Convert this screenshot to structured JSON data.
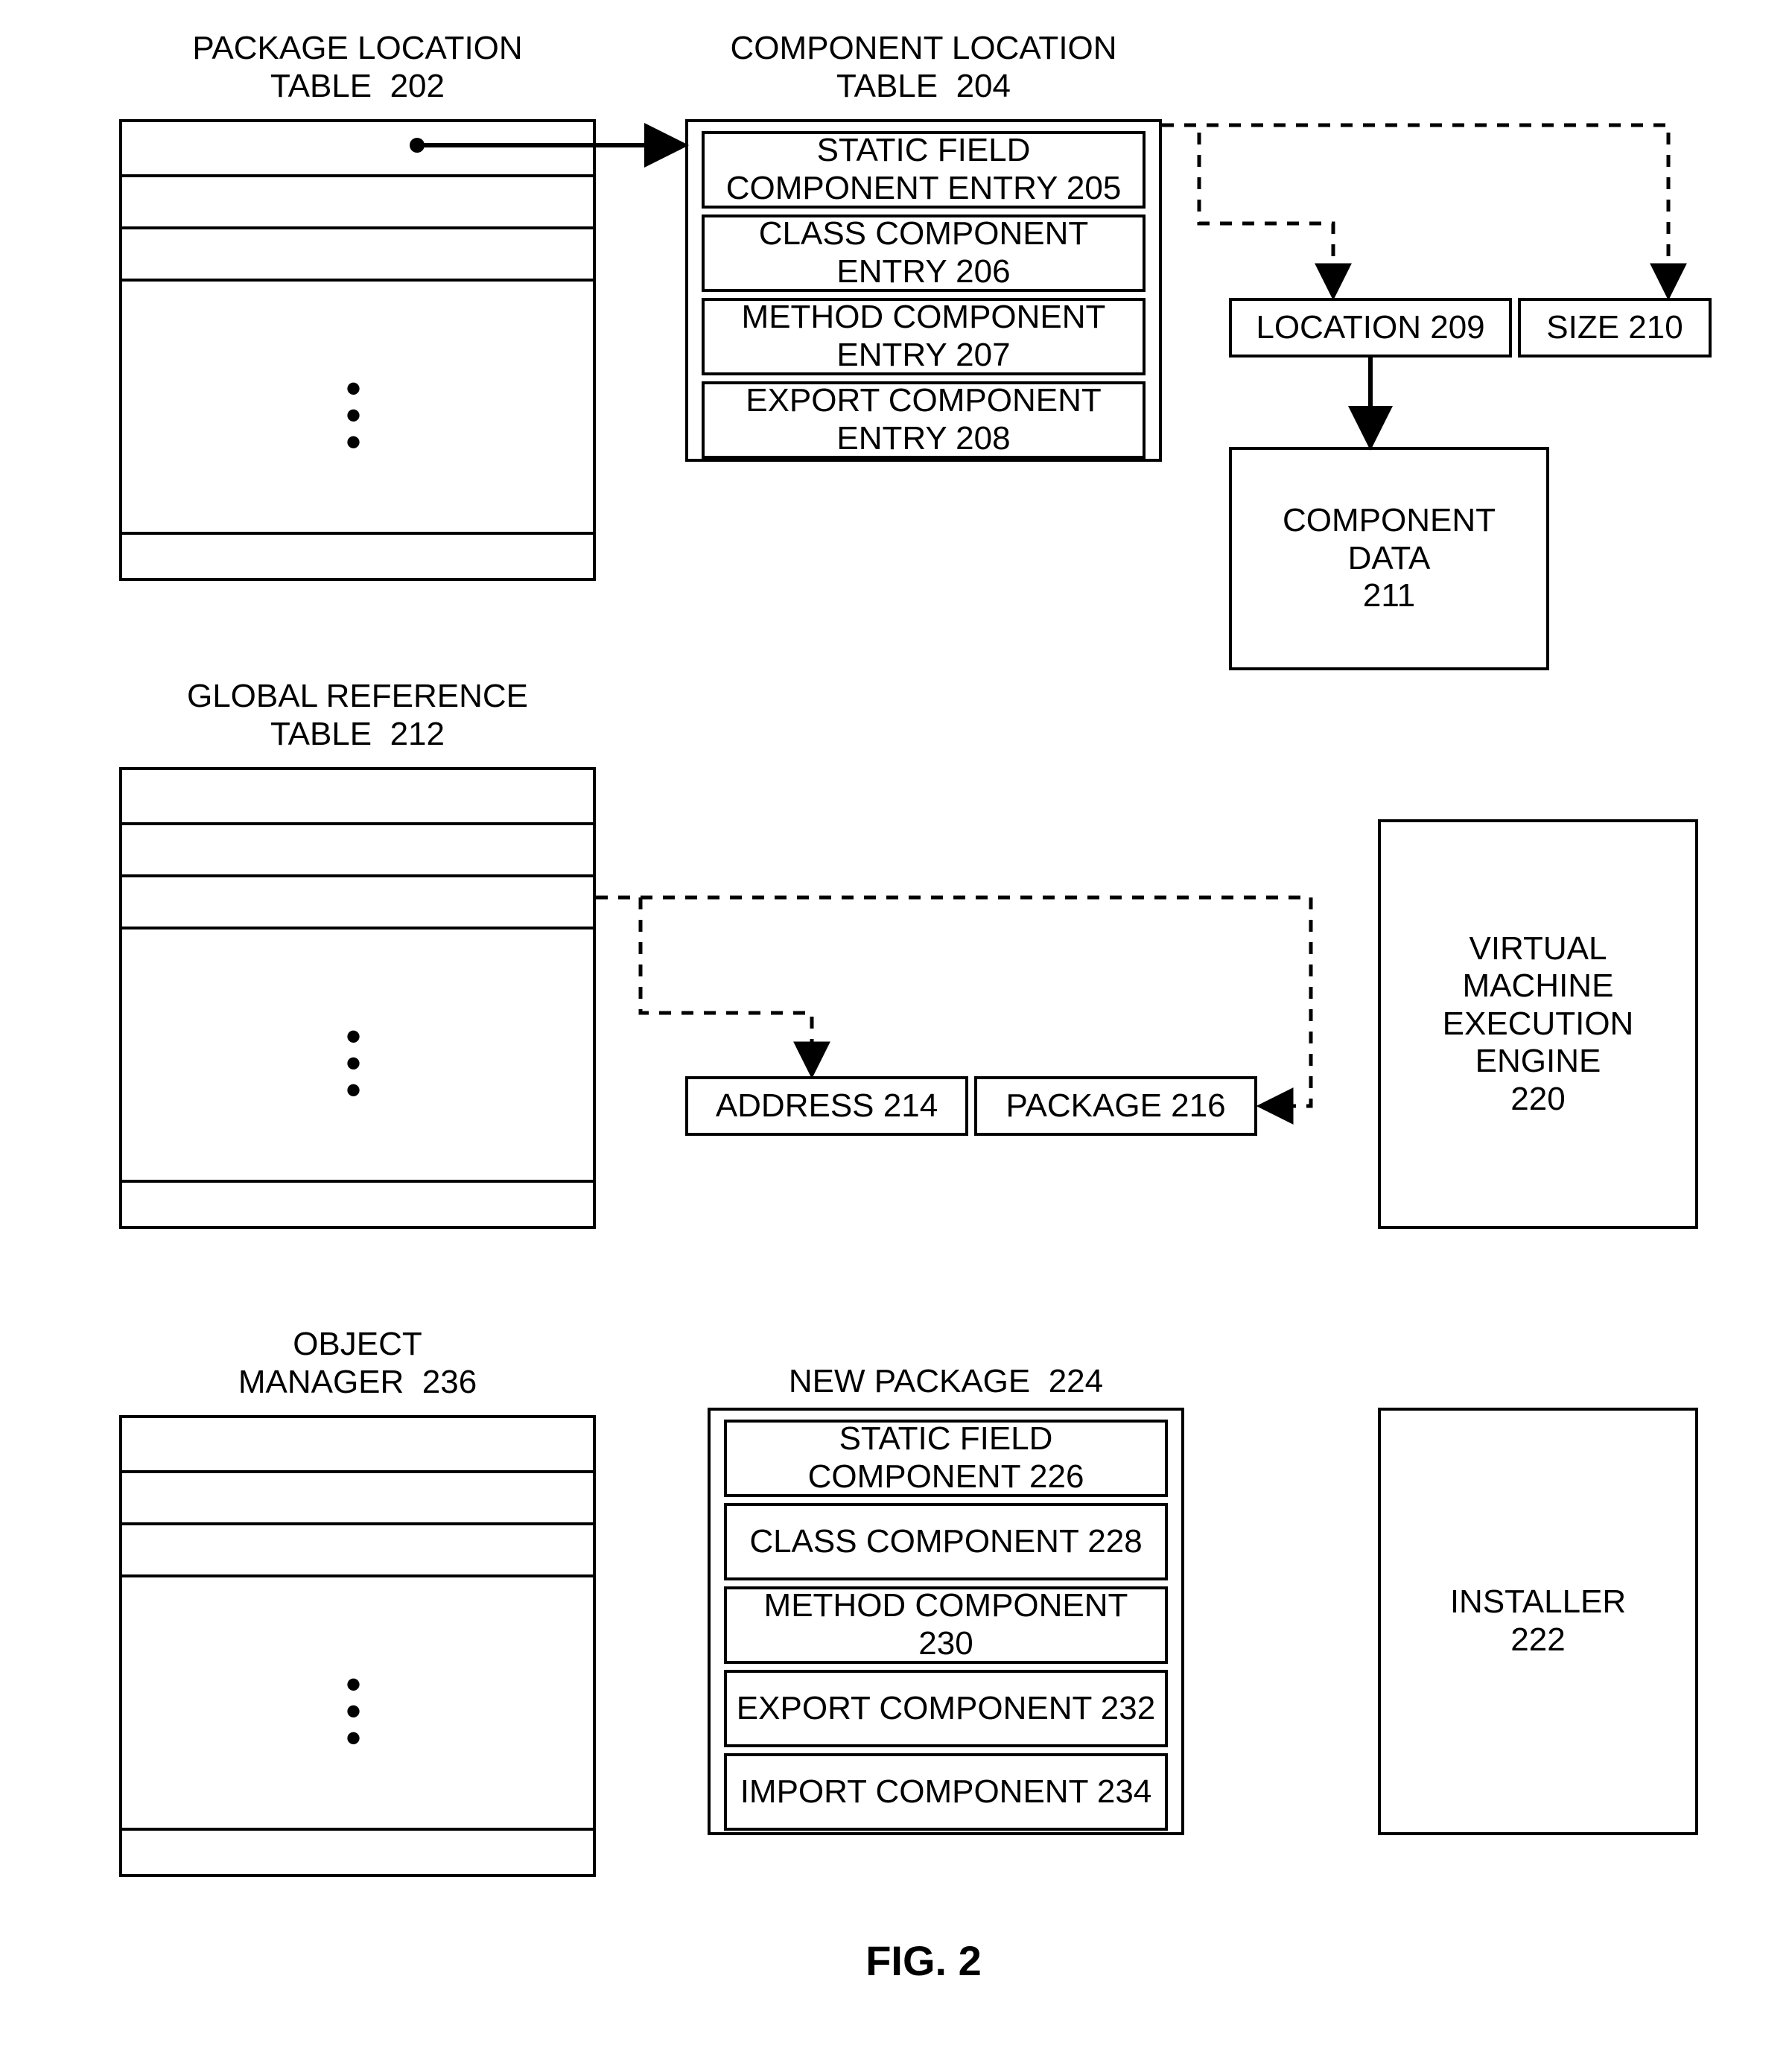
{
  "figure_label": "FIG. 2",
  "package_location_table": {
    "title": "PACKAGE LOCATION\nTABLE  202"
  },
  "component_location_table": {
    "title": "COMPONENT LOCATION\nTABLE  204",
    "entries": {
      "static_field": "STATIC FIELD\nCOMPONENT ENTRY  205",
      "class": "CLASS COMPONENT\nENTRY  206",
      "method": "METHOD COMPONENT\nENTRY  207",
      "export": "EXPORT COMPONENT\nENTRY  208"
    }
  },
  "location_size": {
    "location": "LOCATION  209",
    "size": "SIZE  210"
  },
  "component_data": {
    "label": "COMPONENT\nDATA\n211"
  },
  "global_reference_table": {
    "title": "GLOBAL REFERENCE\nTABLE  212"
  },
  "address_package": {
    "address": "ADDRESS  214",
    "package": "PACKAGE  216"
  },
  "virtual_machine": {
    "label": "VIRTUAL\nMACHINE\nEXECUTION\nENGINE\n220"
  },
  "object_manager": {
    "title": "OBJECT\nMANAGER  236"
  },
  "new_package": {
    "title": "NEW PACKAGE  224",
    "entries": {
      "static_field": "STATIC FIELD COMPONENT\n226",
      "class": "CLASS COMPONENT\n228",
      "method": "METHOD COMPONENT\n230",
      "export": "EXPORT COMPONENT\n232",
      "import": "IMPORT COMPONENT\n234"
    }
  },
  "installer": {
    "label": "INSTALLER\n222"
  }
}
